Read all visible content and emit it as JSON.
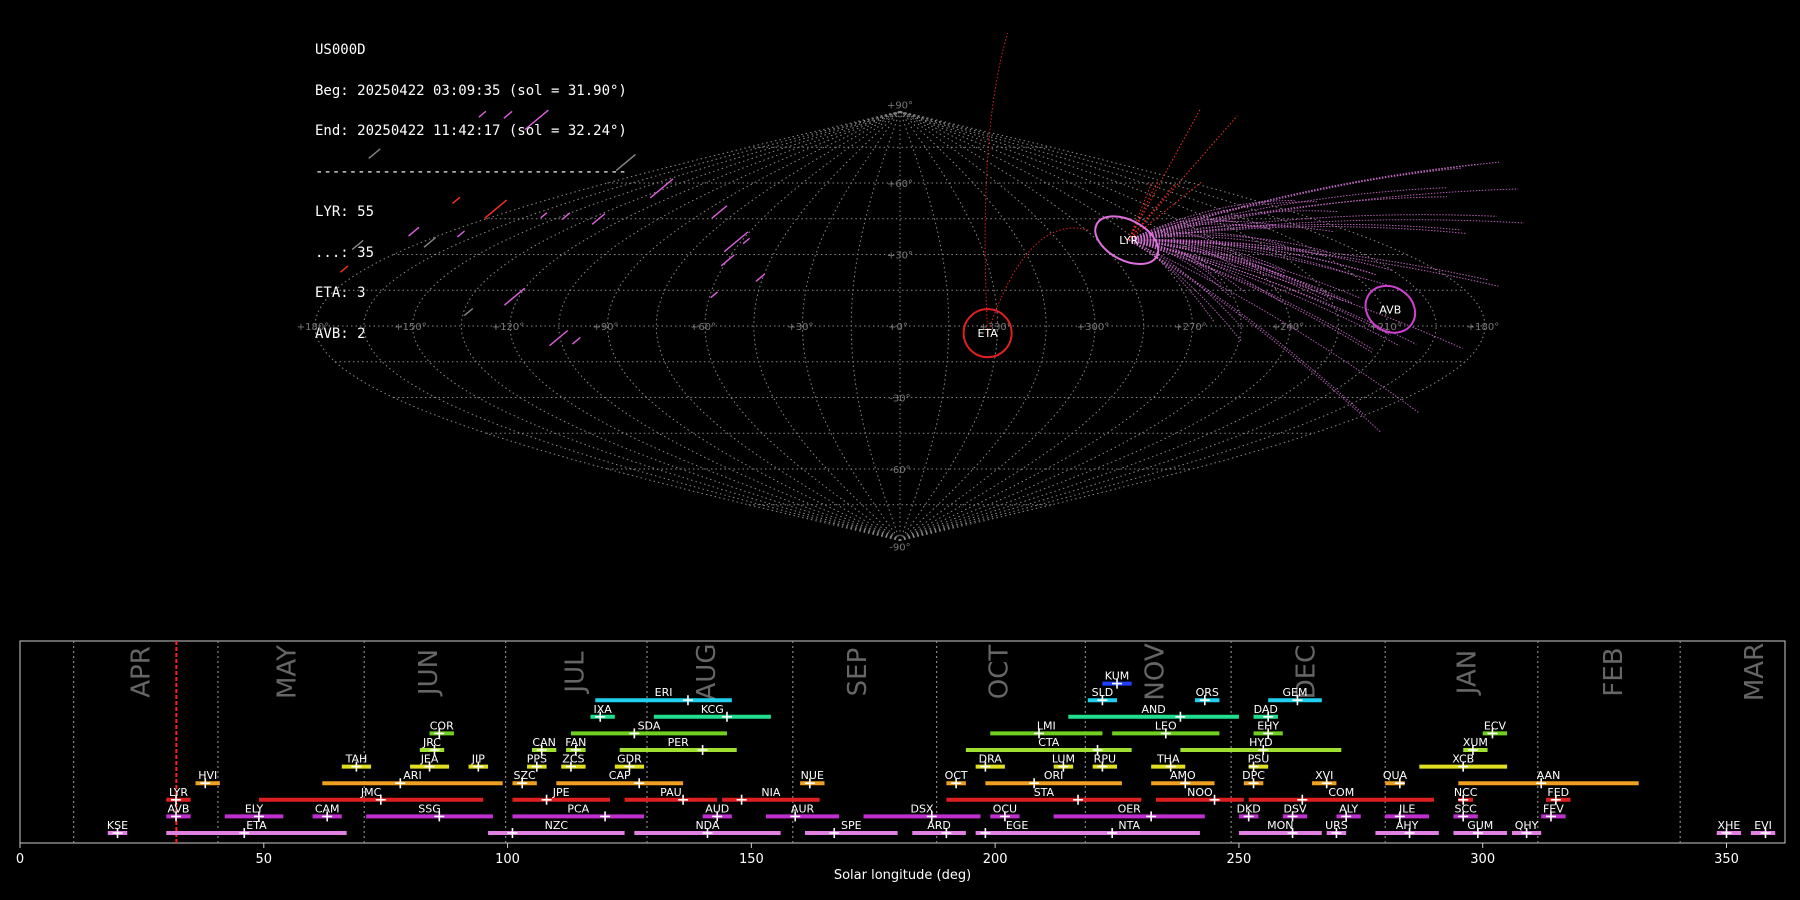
{
  "stats": {
    "station": "US000D",
    "beg": "Beg: 20250422 03:09:35 (sol = 31.90°)",
    "end": "End: 20250422 11:42:17 (sol = 32.24°)",
    "separator": "-------------------------------------",
    "counts": [
      "LYR: 55",
      "...: 35",
      "ETA: 3",
      "AVB: 2"
    ]
  },
  "colors": {
    "background": "#000000",
    "LYR_trails": "#e070e0",
    "sporadic_trails": "#ff3020",
    "grid": "#8a8a8a"
  },
  "chart_data": [
    {
      "type": "scatter",
      "projection": "sinusoidal",
      "lon_labels": [
        "+180°",
        "+150°",
        "+120°",
        "+90°",
        "+60°",
        "+30°",
        "+0°",
        "+330°",
        "+300°",
        "+270°",
        "+240°",
        "+210°",
        "+180°"
      ],
      "lat_labels": [
        "+90°",
        "+60°",
        "+30°",
        "-30°",
        "-60°",
        "-90°"
      ],
      "radiants": [
        {
          "name": "LYR",
          "lon": 273,
          "lat": 36,
          "color": "#e070e0"
        },
        {
          "name": "ETA",
          "lon": 333,
          "lat": -3,
          "color": "#e02020"
        },
        {
          "name": "AVB",
          "lon": 208,
          "lat": 7,
          "color": "#d040d0"
        }
      ]
    },
    {
      "type": "bar",
      "xlabel": "Solar longitude (deg)",
      "xlim": [
        0,
        362
      ],
      "xticks": [
        0,
        50,
        100,
        150,
        200,
        250,
        300,
        350
      ],
      "current_sol": 32.07,
      "months": [
        {
          "name": "APR",
          "start": 11.0
        },
        {
          "name": "MAY",
          "start": 40.6
        },
        {
          "name": "JUN",
          "start": 70.6
        },
        {
          "name": "JUL",
          "start": 99.6
        },
        {
          "name": "AUG",
          "start": 128.6
        },
        {
          "name": "SEP",
          "start": 158.5
        },
        {
          "name": "OCT",
          "start": 188.0
        },
        {
          "name": "NOV",
          "start": 248.0
        },
        {
          "name": "DEC",
          "start": 248.4
        },
        {
          "name": "JAN",
          "start": 280.0
        },
        {
          "name": "FEB",
          "start": 311.3
        },
        {
          "name": "MAR",
          "start": 340.5
        }
      ],
      "month_labels": [
        {
          "name": "APR",
          "x": 25
        },
        {
          "name": "MAY",
          "x": 55
        },
        {
          "name": "JUN",
          "x": 84
        },
        {
          "name": "JUL",
          "x": 114
        },
        {
          "name": "AUG",
          "x": 141
        },
        {
          "name": "SEP",
          "x": 172
        },
        {
          "name": "OCT",
          "x": 201
        },
        {
          "name": "NOV",
          "x": 233
        },
        {
          "name": "DEC",
          "x": 264
        },
        {
          "name": "JAN",
          "x": 297
        },
        {
          "name": "FEB",
          "x": 327
        },
        {
          "name": "MAR",
          "x": 356
        }
      ],
      "month_lines": [
        11.0,
        40.6,
        70.6,
        99.6,
        128.6,
        158.5,
        188.0,
        218.5,
        248.4,
        280.0,
        311.3,
        340.5
      ],
      "showers": [
        {
          "code": "KUM",
          "start": 222,
          "end": 228,
          "peak": 225,
          "row": 9,
          "color": "#2040ff"
        },
        {
          "code": "ERI",
          "start": 118,
          "end": 146,
          "peak": 137,
          "row": 8,
          "color": "#20d0f0"
        },
        {
          "code": "SLD",
          "start": 219,
          "end": 225,
          "peak": 222,
          "row": 8,
          "color": "#20d0f0"
        },
        {
          "code": "ORS",
          "start": 241,
          "end": 246,
          "peak": 243,
          "row": 8,
          "color": "#20d0f0"
        },
        {
          "code": "GEM",
          "start": 256,
          "end": 267,
          "peak": 262,
          "row": 8,
          "color": "#20d0f0"
        },
        {
          "code": "IXA",
          "start": 117,
          "end": 122,
          "peak": 119,
          "row": 7,
          "color": "#20e090"
        },
        {
          "code": "KCG",
          "start": 130,
          "end": 154,
          "peak": 145,
          "row": 7,
          "color": "#20e090"
        },
        {
          "code": "AND",
          "start": 215,
          "end": 250,
          "peak": 238,
          "row": 7,
          "color": "#20e090"
        },
        {
          "code": "DAD",
          "start": 253,
          "end": 258,
          "peak": 256,
          "row": 7,
          "color": "#20e090"
        },
        {
          "code": "COR",
          "start": 84,
          "end": 89,
          "peak": 86,
          "row": 6,
          "color": "#70d020"
        },
        {
          "code": "SDA",
          "start": 113,
          "end": 145,
          "peak": 126,
          "row": 6,
          "color": "#70d020"
        },
        {
          "code": "LMI",
          "start": 199,
          "end": 222,
          "peak": 209,
          "row": 6,
          "color": "#70d020"
        },
        {
          "code": "LEO",
          "start": 224,
          "end": 246,
          "peak": 235,
          "row": 6,
          "color": "#70d020"
        },
        {
          "code": "EHY",
          "start": 253,
          "end": 259,
          "peak": 256,
          "row": 6,
          "color": "#70d020"
        },
        {
          "code": "ECV",
          "start": 300,
          "end": 305,
          "peak": 302,
          "row": 6,
          "color": "#70d020"
        },
        {
          "code": "JRC",
          "start": 82,
          "end": 87,
          "peak": 85,
          "row": 5,
          "color": "#a0e030"
        },
        {
          "code": "CAN",
          "start": 105,
          "end": 110,
          "peak": 107,
          "row": 5,
          "color": "#a0e030"
        },
        {
          "code": "FAN",
          "start": 112,
          "end": 116,
          "peak": 114,
          "row": 5,
          "color": "#a0e030"
        },
        {
          "code": "PER",
          "start": 123,
          "end": 147,
          "peak": 140,
          "row": 5,
          "color": "#a0e030"
        },
        {
          "code": "CTA",
          "start": 194,
          "end": 228,
          "peak": 221,
          "row": 5,
          "color": "#a0e030"
        },
        {
          "code": "HYD",
          "start": 238,
          "end": 271,
          "peak": 255,
          "row": 5,
          "color": "#a0e030"
        },
        {
          "code": "XUM",
          "start": 296,
          "end": 301,
          "peak": 298,
          "row": 5,
          "color": "#a0e030"
        },
        {
          "code": "TAH",
          "start": 66,
          "end": 72,
          "peak": 69,
          "row": 4,
          "color": "#e0e020"
        },
        {
          "code": "JEA",
          "start": 80,
          "end": 88,
          "peak": 84,
          "row": 4,
          "color": "#e0e020"
        },
        {
          "code": "JIP",
          "start": 92,
          "end": 96,
          "peak": 94,
          "row": 4,
          "color": "#e0e020"
        },
        {
          "code": "PPS",
          "start": 104,
          "end": 108,
          "peak": 106,
          "row": 4,
          "color": "#e0e020"
        },
        {
          "code": "ZCS",
          "start": 111,
          "end": 116,
          "peak": 113,
          "row": 4,
          "color": "#e0e020"
        },
        {
          "code": "GDR",
          "start": 122,
          "end": 128,
          "peak": 125,
          "row": 4,
          "color": "#e0e020"
        },
        {
          "code": "DRA",
          "start": 196,
          "end": 202,
          "peak": 198,
          "row": 4,
          "color": "#e0e020"
        },
        {
          "code": "LUM",
          "start": 212,
          "end": 216,
          "peak": 214,
          "row": 4,
          "color": "#e0e020"
        },
        {
          "code": "RPU",
          "start": 220,
          "end": 225,
          "peak": 222,
          "row": 4,
          "color": "#e0e020"
        },
        {
          "code": "THA",
          "start": 232,
          "end": 239,
          "peak": 236,
          "row": 4,
          "color": "#e0e020"
        },
        {
          "code": "PSU",
          "start": 252,
          "end": 256,
          "peak": 253,
          "row": 4,
          "color": "#e0e020"
        },
        {
          "code": "XCB",
          "start": 287,
          "end": 305,
          "peak": 296,
          "row": 4,
          "color": "#e0e020"
        },
        {
          "code": "HVI",
          "start": 36,
          "end": 41,
          "peak": 38,
          "row": 3,
          "color": "#f0a020"
        },
        {
          "code": "ARI",
          "start": 62,
          "end": 99,
          "peak": 78,
          "row": 3,
          "color": "#f0a020"
        },
        {
          "code": "SZC",
          "start": 101,
          "end": 106,
          "peak": 103,
          "row": 3,
          "color": "#f0a020"
        },
        {
          "code": "CAP",
          "start": 110,
          "end": 136,
          "peak": 127,
          "row": 3,
          "color": "#f0a020"
        },
        {
          "code": "NUE",
          "start": 160,
          "end": 165,
          "peak": 162,
          "row": 3,
          "color": "#f0a020"
        },
        {
          "code": "OCT",
          "start": 190,
          "end": 194,
          "peak": 192,
          "row": 3,
          "color": "#f0a020"
        },
        {
          "code": "ORI",
          "start": 198,
          "end": 226,
          "peak": 208,
          "row": 3,
          "color": "#f0a020"
        },
        {
          "code": "AMO",
          "start": 232,
          "end": 245,
          "peak": 239,
          "row": 3,
          "color": "#f0a020"
        },
        {
          "code": "DPC",
          "start": 251,
          "end": 255,
          "peak": 253,
          "row": 3,
          "color": "#f0a020"
        },
        {
          "code": "XVI",
          "start": 265,
          "end": 270,
          "peak": 268,
          "row": 3,
          "color": "#f0a020"
        },
        {
          "code": "QUA",
          "start": 280,
          "end": 284,
          "peak": 283,
          "row": 3,
          "color": "#f0a020"
        },
        {
          "code": "AAN",
          "start": 295,
          "end": 332,
          "peak": 312,
          "row": 3,
          "color": "#f0a020"
        },
        {
          "code": "LYR",
          "start": 30,
          "end": 35,
          "peak": 32,
          "row": 2,
          "color": "#e02020"
        },
        {
          "code": "JMC",
          "start": 49,
          "end": 95,
          "peak": 74,
          "row": 2,
          "color": "#e02020"
        },
        {
          "code": "JPE",
          "start": 101,
          "end": 121,
          "peak": 108,
          "row": 2,
          "color": "#e02020"
        },
        {
          "code": "PAU",
          "start": 124,
          "end": 143,
          "peak": 136,
          "row": 2,
          "color": "#e02020"
        },
        {
          "code": "NIA",
          "start": 144,
          "end": 164,
          "peak": 148,
          "row": 2,
          "color": "#e02020"
        },
        {
          "code": "STA",
          "start": 190,
          "end": 230,
          "peak": 217,
          "row": 2,
          "color": "#e02020"
        },
        {
          "code": "NOO",
          "start": 233,
          "end": 251,
          "peak": 245,
          "row": 2,
          "color": "#e02020"
        },
        {
          "code": "COM",
          "start": 252,
          "end": 290,
          "peak": 263,
          "row": 2,
          "color": "#e02020"
        },
        {
          "code": "NCC",
          "start": 295,
          "end": 298,
          "peak": 296,
          "row": 2,
          "color": "#e02020"
        },
        {
          "code": "FED",
          "start": 313,
          "end": 318,
          "peak": 315,
          "row": 2,
          "color": "#e02020"
        },
        {
          "code": "AVB",
          "start": 30,
          "end": 35,
          "peak": 32,
          "row": 1,
          "color": "#c030d0"
        },
        {
          "code": "ELY",
          "start": 42,
          "end": 54,
          "peak": 49,
          "row": 1,
          "color": "#c030d0"
        },
        {
          "code": "CAM",
          "start": 60,
          "end": 66,
          "peak": 63,
          "row": 1,
          "color": "#c030d0"
        },
        {
          "code": "SSG",
          "start": 71,
          "end": 97,
          "peak": 86,
          "row": 1,
          "color": "#c030d0"
        },
        {
          "code": "PCA",
          "start": 101,
          "end": 128,
          "peak": 120,
          "row": 1,
          "color": "#c030d0"
        },
        {
          "code": "AUD",
          "start": 140,
          "end": 146,
          "peak": 143,
          "row": 1,
          "color": "#c030d0"
        },
        {
          "code": "AUR",
          "start": 153,
          "end": 168,
          "peak": 159,
          "row": 1,
          "color": "#c030d0"
        },
        {
          "code": "DSX",
          "start": 173,
          "end": 197,
          "peak": 187,
          "row": 1,
          "color": "#c030d0"
        },
        {
          "code": "OCU",
          "start": 199,
          "end": 205,
          "peak": 202,
          "row": 1,
          "color": "#c030d0"
        },
        {
          "code": "OER",
          "start": 212,
          "end": 243,
          "peak": 232,
          "row": 1,
          "color": "#c030d0"
        },
        {
          "code": "DKD",
          "start": 250,
          "end": 254,
          "peak": 252,
          "row": 1,
          "color": "#c030d0"
        },
        {
          "code": "DSV",
          "start": 259,
          "end": 264,
          "peak": 261,
          "row": 1,
          "color": "#c030d0"
        },
        {
          "code": "ALY",
          "start": 270,
          "end": 275,
          "peak": 272,
          "row": 1,
          "color": "#c030d0"
        },
        {
          "code": "JLE",
          "start": 280,
          "end": 289,
          "peak": 283,
          "row": 1,
          "color": "#c030d0"
        },
        {
          "code": "SCC",
          "start": 294,
          "end": 299,
          "peak": 296,
          "row": 1,
          "color": "#c030d0"
        },
        {
          "code": "FEV",
          "start": 312,
          "end": 317,
          "peak": 314,
          "row": 1,
          "color": "#c030d0"
        },
        {
          "code": "KSE",
          "start": 18,
          "end": 22,
          "peak": 20,
          "row": 0,
          "color": "#e080e0"
        },
        {
          "code": "ETA",
          "start": 30,
          "end": 67,
          "peak": 46,
          "row": 0,
          "color": "#e080e0"
        },
        {
          "code": "NZC",
          "start": 96,
          "end": 124,
          "peak": 101,
          "row": 0,
          "color": "#e080e0"
        },
        {
          "code": "NDA",
          "start": 126,
          "end": 156,
          "peak": 141,
          "row": 0,
          "color": "#e080e0"
        },
        {
          "code": "SPE",
          "start": 161,
          "end": 180,
          "peak": 167,
          "row": 0,
          "color": "#e080e0"
        },
        {
          "code": "ARD",
          "start": 183,
          "end": 194,
          "peak": 190,
          "row": 0,
          "color": "#e080e0"
        },
        {
          "code": "EGE",
          "start": 196,
          "end": 213,
          "peak": 198,
          "row": 0,
          "color": "#e080e0"
        },
        {
          "code": "NTA",
          "start": 213,
          "end": 242,
          "peak": 224,
          "row": 0,
          "color": "#e080e0"
        },
        {
          "code": "MON",
          "start": 250,
          "end": 267,
          "peak": 261,
          "row": 0,
          "color": "#e080e0"
        },
        {
          "code": "URS",
          "start": 268,
          "end": 272,
          "peak": 270,
          "row": 0,
          "color": "#e080e0"
        },
        {
          "code": "AHY",
          "start": 278,
          "end": 291,
          "peak": 285,
          "row": 0,
          "color": "#e080e0"
        },
        {
          "code": "GUM",
          "start": 294,
          "end": 305,
          "peak": 299,
          "row": 0,
          "color": "#e080e0"
        },
        {
          "code": "QHY",
          "start": 306,
          "end": 312,
          "peak": 309,
          "row": 0,
          "color": "#e080e0"
        },
        {
          "code": "XHE",
          "start": 348,
          "end": 353,
          "peak": 350,
          "row": 0,
          "color": "#e080e0"
        },
        {
          "code": "EVI",
          "start": 355,
          "end": 360,
          "peak": 358,
          "row": 0,
          "color": "#e080e0"
        }
      ]
    }
  ]
}
